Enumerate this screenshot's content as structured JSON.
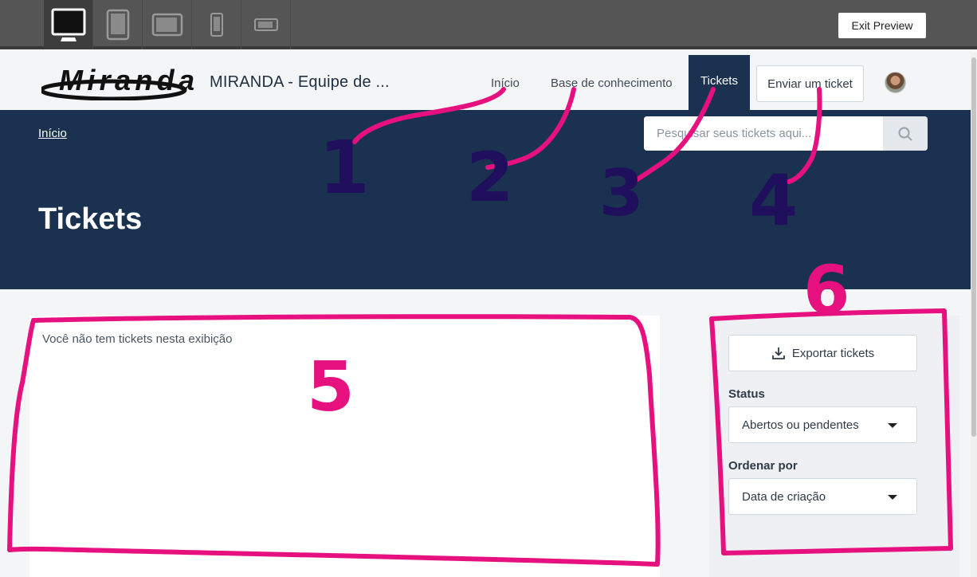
{
  "preview_bar": {
    "devices": [
      "desktop-icon",
      "tablet-portrait-icon",
      "tablet-landscape-icon",
      "phone-portrait-icon",
      "phone-landscape-icon"
    ],
    "active_device": "desktop",
    "exit_label": "Exit Preview"
  },
  "header": {
    "logo_text": "Miranda",
    "brand_name": "MIRANDA - Equipe de ...",
    "nav": {
      "home": "Início",
      "knowledge_base": "Base de conhecimento",
      "tickets": "Tickets",
      "submit": "Enviar um ticket"
    }
  },
  "hero": {
    "breadcrumb": "Início",
    "search_placeholder": "Pesquisar seus tickets aqui...",
    "title": "Tickets"
  },
  "main": {
    "empty_message": "Você não tem tickets nesta exibição"
  },
  "sidebar": {
    "export_label": "Exportar tickets",
    "status_label": "Status",
    "status_value": "Abertos ou pendentes",
    "sort_label": "Ordenar por",
    "sort_value": "Data de criação"
  },
  "annotations": {
    "numbers": [
      "1",
      "2",
      "3",
      "4",
      "5",
      "6"
    ],
    "colors": {
      "pink": "#e6117f",
      "navy": "#1f0f5c"
    }
  },
  "colors": {
    "brand_navy": "#1a324f",
    "toolbar": "#555555"
  }
}
